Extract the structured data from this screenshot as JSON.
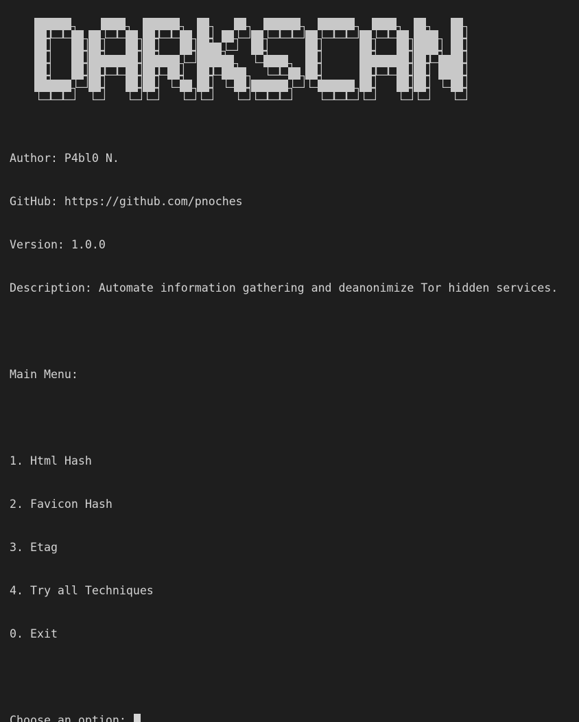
{
  "banner": {
    "text": "DARKSCAN",
    "fill_color": "#c8c8c8",
    "outline_color": "#c8c8c8"
  },
  "info": [
    "Author: P4bl0 N.",
    "GitHub: https://github.com/pnoches",
    "Version: 1.0.0",
    "Description: Automate information gathering and deanonimize Tor hidden services."
  ],
  "menu": {
    "title": "Main Menu:",
    "items": [
      "1. Html Hash",
      "2. Favicon Hash",
      "3. Etag",
      "4. Try all Techniques",
      "0. Exit"
    ]
  },
  "prompt": {
    "text": "Choose an option: ",
    "value": ""
  },
  "colors": {
    "background": "#1e1e1e",
    "foreground": "#d4d4d4"
  }
}
